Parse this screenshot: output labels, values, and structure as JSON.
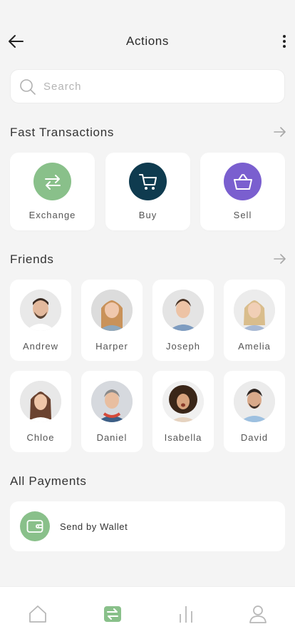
{
  "header": {
    "title": "Actions",
    "back_icon": "arrow-left-icon",
    "more_icon": "vertical-dots-icon"
  },
  "search": {
    "placeholder": "Search",
    "value": "",
    "icon": "search-icon"
  },
  "fast_transactions": {
    "title": "Fast Transactions",
    "arrow_icon": "arrow-right-icon",
    "items": [
      {
        "label": "Exchange",
        "icon": "exchange-icon",
        "color": "#89c08a"
      },
      {
        "label": "Buy",
        "icon": "cart-icon",
        "color": "#0f3b4f"
      },
      {
        "label": "Sell",
        "icon": "basket-icon",
        "color": "#7a5fcf"
      }
    ]
  },
  "friends": {
    "title": "Friends",
    "arrow_icon": "arrow-right-icon",
    "items": [
      {
        "name": "Andrew"
      },
      {
        "name": "Harper"
      },
      {
        "name": "Joseph"
      },
      {
        "name": "Amelia"
      },
      {
        "name": "Chloe"
      },
      {
        "name": "Daniel"
      },
      {
        "name": "Isabella"
      },
      {
        "name": "David"
      }
    ]
  },
  "payments": {
    "title": "All Payments",
    "items": [
      {
        "label": "Send by Wallet",
        "icon": "wallet-icon",
        "color": "#89c08a"
      }
    ]
  },
  "tabbar": {
    "items": [
      {
        "icon": "home-icon",
        "active": false
      },
      {
        "icon": "transfer-icon",
        "active": true,
        "color": "#89c08a"
      },
      {
        "icon": "chart-bars-icon",
        "active": false
      },
      {
        "icon": "user-icon",
        "active": false
      }
    ]
  }
}
